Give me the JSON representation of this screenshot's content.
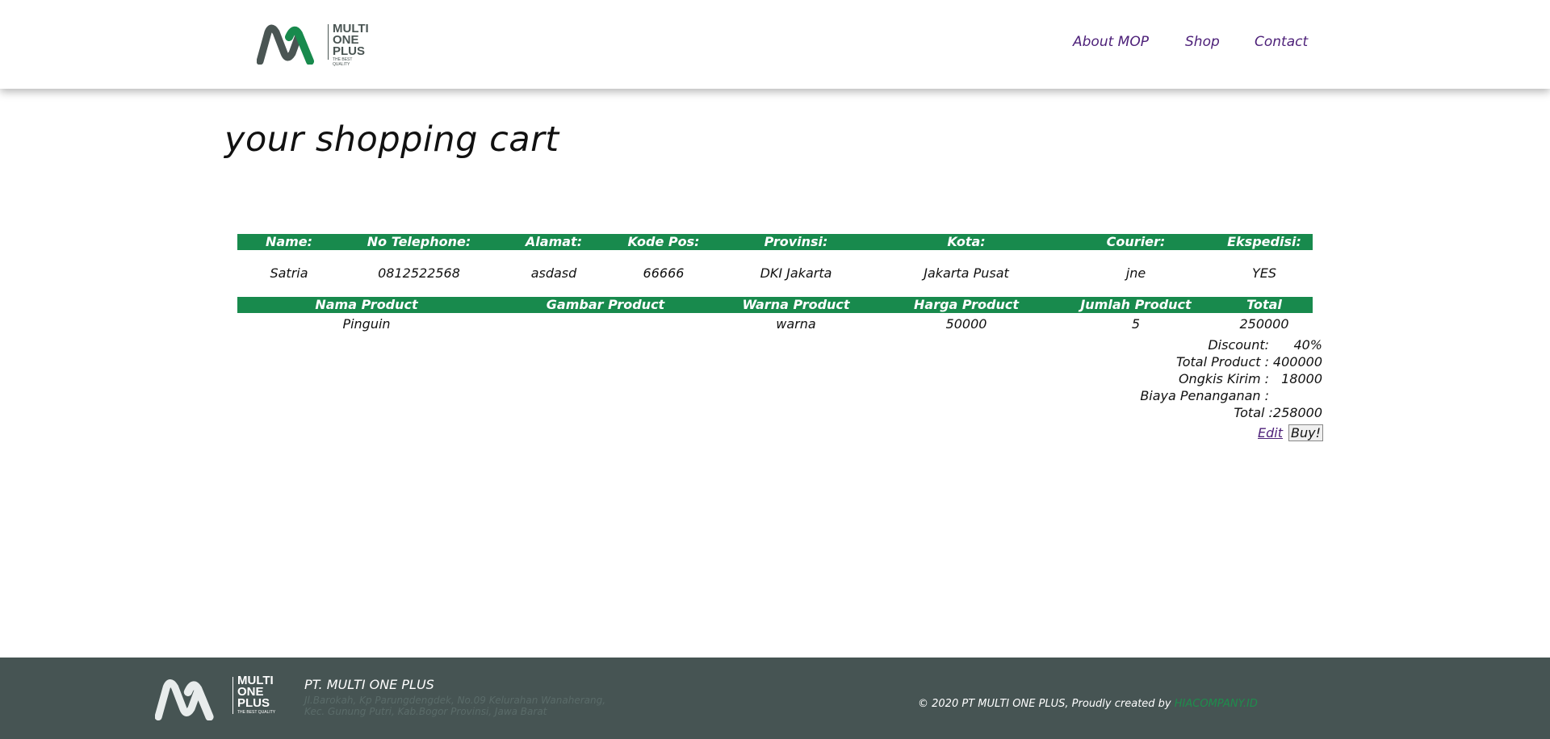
{
  "colors": {
    "brand_green": "#188a4d",
    "brand_purple": "#4c1f78",
    "logo_gray": "#4a5553",
    "footer_bg": "#465453"
  },
  "header": {
    "logo": {
      "line1": "MULTI",
      "line2": "ONE",
      "line3": "PLUS",
      "tagline": "THE BEST QUALITY"
    },
    "nav": [
      "About MOP",
      "Shop",
      "Contact"
    ]
  },
  "page": {
    "title": "your shopping cart"
  },
  "customer_table": {
    "headers": [
      "Name:",
      "No Telephone:",
      "Alamat:",
      "Kode Pos:",
      "Provinsi:",
      "Kota:",
      "Courier:",
      "Ekspedisi:"
    ],
    "row": [
      "Satria",
      "0812522568",
      "asdasd",
      "66666",
      "DKI Jakarta",
      "Jakarta Pusat",
      "jne",
      "YES"
    ]
  },
  "product_table": {
    "headers": [
      "Nama Product",
      "Gambar Product",
      "Warna Product",
      "Harga Product",
      "Jumlah Product",
      "Total"
    ],
    "row": [
      "Pinguin",
      "",
      "warna",
      "50000",
      "5",
      "250000"
    ]
  },
  "summary": {
    "discount_label": "Discount:",
    "discount_value": "40%",
    "total_product_label": "Total Product :",
    "total_product_value": "400000",
    "ongkir_label": "Ongkis Kirim :",
    "ongkir_value": "18000",
    "biaya_label": "Biaya Penanganan :",
    "biaya_value": "",
    "total_label": "Total :",
    "total_value": "258000"
  },
  "actions": {
    "edit_label": "Edit",
    "buy_label": "Buy!"
  },
  "footer": {
    "logo": {
      "line1": "MULTI",
      "line2": "ONE",
      "line3": "PLUS",
      "tagline": "THE BEST QUALITY"
    },
    "company": "PT. MULTI ONE PLUS",
    "address": "Jl.Barokah, Kp Parungdengdek, No.09 Kelurahan Wanaherang, Kec. Gunung Putri, Kab.Bogor Provinsi, Jawa Barat",
    "copyright": "© 2020 PT MULTI ONE PLUS, Proudly created by",
    "credit": "HIACOMPANY.ID"
  }
}
